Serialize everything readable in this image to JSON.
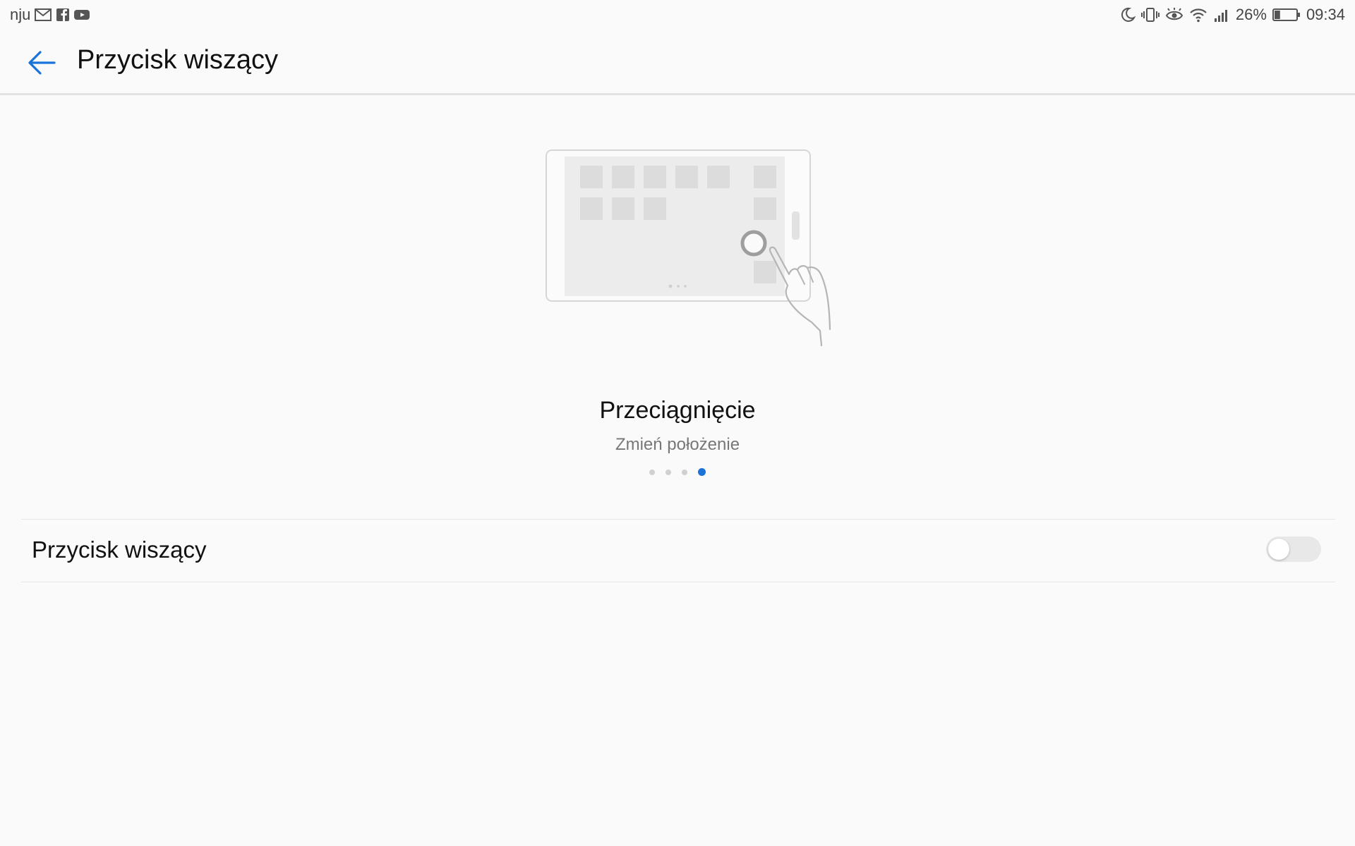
{
  "status_bar": {
    "carrier": "nju",
    "notification_icons": [
      "gmail-icon",
      "facebook-icon",
      "youtube-icon"
    ],
    "system_icons": [
      "do-not-disturb-icon",
      "vibrate-icon",
      "eye-comfort-icon",
      "wifi-icon",
      "signal-icon"
    ],
    "battery_percent": "26%",
    "battery_level": 0.26,
    "time": "09:34"
  },
  "appbar": {
    "title": "Przycisk wiszący",
    "back_icon": "arrow-back-icon"
  },
  "tutorial": {
    "title": "Przeciągnięcie",
    "subtitle": "Zmień położenie",
    "page_count": 4,
    "active_page": 4
  },
  "settings": {
    "floating_button": {
      "label": "Przycisk wiszący",
      "enabled": false
    }
  },
  "colors": {
    "accent": "#1a73d9",
    "background": "#fafafa",
    "divider": "#e6e6e6",
    "switch_off_track": "#e8e8e8"
  }
}
